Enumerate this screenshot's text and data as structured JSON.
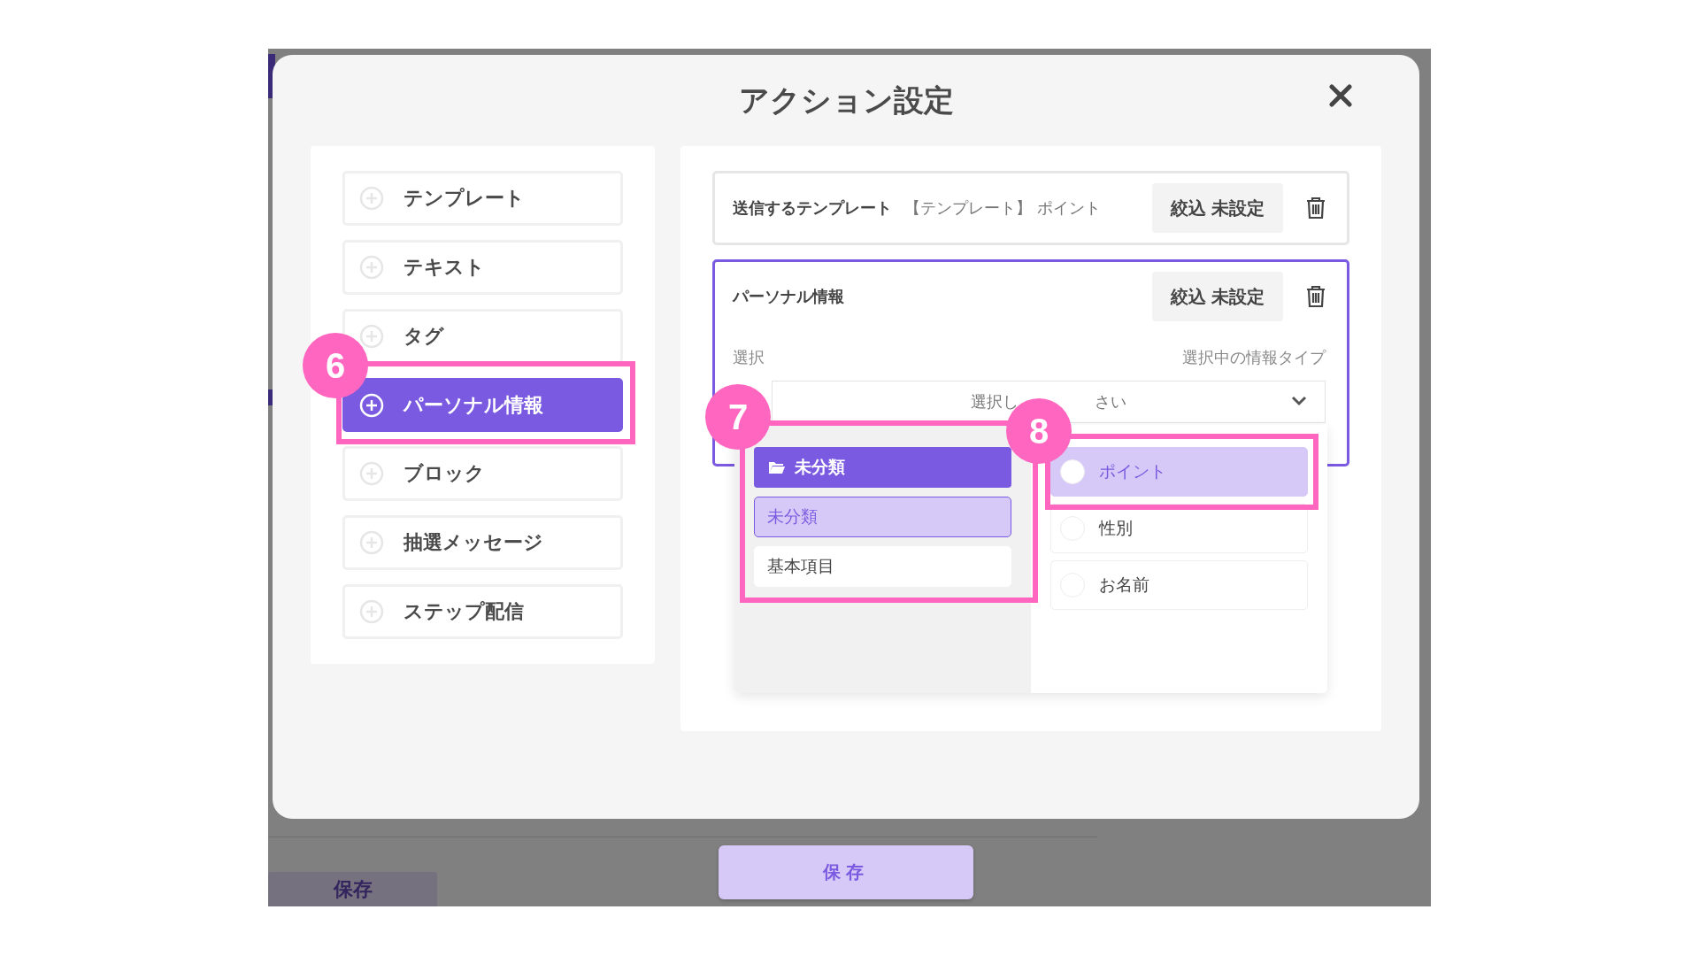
{
  "background_app": {
    "save_button": "保存"
  },
  "dialog": {
    "title": "アクション設定",
    "action_types": [
      {
        "label": "テンプレート",
        "selected": false
      },
      {
        "label": "テキスト",
        "selected": false
      },
      {
        "label": "タグ",
        "selected": false
      },
      {
        "label": "パーソナル情報",
        "selected": true
      },
      {
        "label": "ブロック",
        "selected": false
      },
      {
        "label": "抽選メッセージ",
        "selected": false
      },
      {
        "label": "ステップ配信",
        "selected": false
      }
    ],
    "actions": [
      {
        "kind": "template",
        "active": false,
        "title": "送信するテンプレート",
        "value": "【テンプレート】 ポイント",
        "filter_button": "絞込 未設定"
      },
      {
        "kind": "personal_info",
        "active": true,
        "title": "パーソナル情報",
        "filter_button": "絞込 未設定",
        "select_label": "選択",
        "type_label": "選択中の情報タイプ",
        "select": {
          "placeholder_parts": [
            "選択し",
            "さい"
          ]
        }
      }
    ],
    "dropdown": {
      "folder": "未分類",
      "categories": [
        {
          "label": "未分類",
          "selected": true
        },
        {
          "label": "基本項目",
          "selected": false
        }
      ],
      "options": [
        {
          "label": "ポイント",
          "selected": true
        },
        {
          "label": "性別",
          "selected": false
        },
        {
          "label": "お名前",
          "selected": false
        }
      ]
    }
  },
  "save_button": "保存",
  "annotations": [
    {
      "number": "6"
    },
    {
      "number": "7"
    },
    {
      "number": "8"
    }
  ]
}
